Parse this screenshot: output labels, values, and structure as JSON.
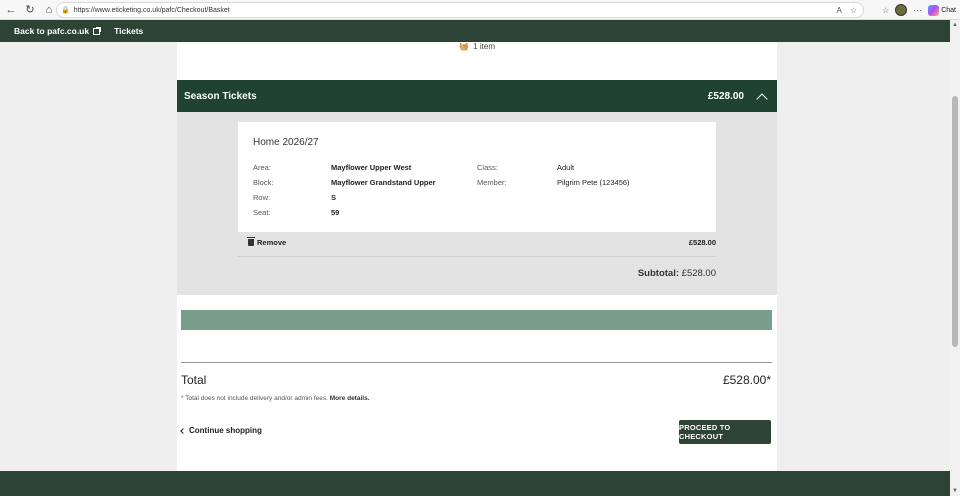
{
  "browser": {
    "url": "https://www.eticketing.co.uk/pafc/Checkout/Basket",
    "chat_label": "Chat"
  },
  "header": {
    "back_link": "Back to pafc.co.uk",
    "tickets_link": "Tickets"
  },
  "basket": {
    "items_count": "1 item"
  },
  "season": {
    "title": "Season Tickets",
    "price": "£528.00"
  },
  "ticket": {
    "title": "Home 2026/27",
    "area_label": "Area:",
    "area_value": "Mayflower Upper West",
    "block_label": "Block:",
    "block_value": "Mayflower Grandstand Upper",
    "row_label": "Row:",
    "row_value": "S",
    "seat_label": "Seat:",
    "seat_value": "59",
    "class_label": "Class:",
    "class_value": "Adult",
    "member_label": "Member:",
    "member_value": "Pilgrim Pete (123456)",
    "remove_label": "Remove",
    "line_price": "£528.00",
    "subtotal_label": "Subtotal:",
    "subtotal_value": "£528.00"
  },
  "summary": {
    "total_label": "Total",
    "total_value": "£528.00*",
    "disclaimer_text": "* Total does not include delivery and/or admin fees.",
    "more_details": "More details.",
    "continue_label": "Continue shopping",
    "proceed_label": "PROCEED TO CHECKOUT"
  },
  "colors": {
    "brand_green": "#2d4335",
    "season_bar": "#1f4233",
    "strip": "#7a9e8c"
  }
}
